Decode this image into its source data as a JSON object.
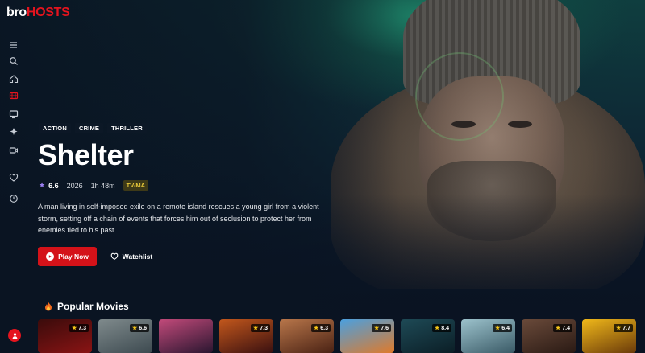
{
  "brand": {
    "name_part1": "bro",
    "name_part2": "HOSTS",
    "accent": "#e5141e"
  },
  "sidebar": {
    "items": [
      {
        "icon": "menu-icon",
        "active": false
      },
      {
        "icon": "search-icon",
        "active": false
      },
      {
        "icon": "home-icon",
        "active": false
      },
      {
        "icon": "film-icon",
        "active": true
      },
      {
        "icon": "tv-icon",
        "active": false
      },
      {
        "icon": "sparkle-icon",
        "active": false
      },
      {
        "icon": "video-camera-icon",
        "active": false
      },
      {
        "icon": "heart-icon",
        "active": false
      },
      {
        "icon": "clock-icon",
        "active": false
      }
    ],
    "avatar_icon": "user-icon"
  },
  "hero": {
    "genres": [
      "ACTION",
      "CRIME",
      "THRILLER"
    ],
    "title": "Shelter",
    "rating": "6.6",
    "year": "2026",
    "runtime": "1h 48m",
    "certification": "TV-MA",
    "description": "A man living in self-imposed exile on a remote island rescues a young girl from a violent storm, setting off a chain of events that forces him out of seclusion to protect her from enemies tied to his past.",
    "play_label": "Play Now",
    "watchlist_label": "Watchlist"
  },
  "popular": {
    "title": "Popular Movies",
    "movies": [
      {
        "rating": "7.3",
        "colors": [
          "#3a0b0b",
          "#8a1414"
        ]
      },
      {
        "rating": "6.6",
        "colors": [
          "#7f8a8c",
          "#3d4a50"
        ]
      },
      {
        "rating": "",
        "colors": [
          "#c24a7a",
          "#2a1630"
        ]
      },
      {
        "rating": "7.3",
        "colors": [
          "#c2571c",
          "#3a1010"
        ]
      },
      {
        "rating": "6.3",
        "colors": [
          "#b8764a",
          "#4a2214"
        ]
      },
      {
        "rating": "7.6",
        "colors": [
          "#4aa0e0",
          "#e07a2a"
        ]
      },
      {
        "rating": "8.4",
        "colors": [
          "#1e4a56",
          "#0b1e26"
        ]
      },
      {
        "rating": "6.4",
        "colors": [
          "#9cc2cc",
          "#3a5a66"
        ]
      },
      {
        "rating": "7.4",
        "colors": [
          "#6a4a3a",
          "#2a1a14"
        ]
      },
      {
        "rating": "7.7",
        "colors": [
          "#f0b81a",
          "#6a3a0a"
        ]
      }
    ]
  }
}
